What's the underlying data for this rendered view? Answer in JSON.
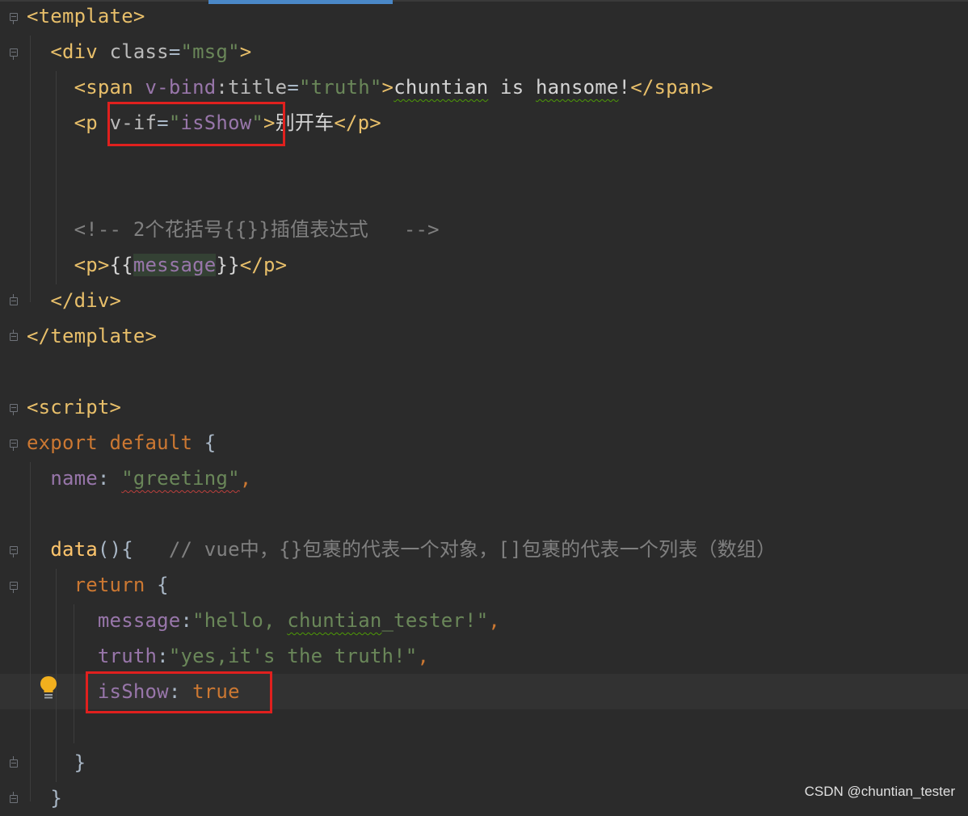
{
  "editor": {
    "lines": [
      {
        "tokens": [
          {
            "t": "<template>",
            "c": "tag"
          }
        ]
      },
      {
        "tokens": [
          {
            "t": "  "
          },
          {
            "t": "<div ",
            "c": "tag"
          },
          {
            "t": "class",
            "c": "attr"
          },
          {
            "t": "=",
            "c": "plain"
          },
          {
            "t": "\"msg\"",
            "c": "str"
          },
          {
            "t": ">",
            "c": "tag"
          }
        ]
      },
      {
        "tokens": [
          {
            "t": "    "
          },
          {
            "t": "<span ",
            "c": "tag"
          },
          {
            "t": "v-bind",
            "c": "vattr"
          },
          {
            "t": ":title",
            "c": "attr"
          },
          {
            "t": "=",
            "c": "plain"
          },
          {
            "t": "\"truth\"",
            "c": "str"
          },
          {
            "t": ">",
            "c": "tag"
          },
          {
            "t": "chuntian",
            "c": "txt squig"
          },
          {
            "t": " is ",
            "c": "txt"
          },
          {
            "t": "hansome",
            "c": "txt squig"
          },
          {
            "t": "!",
            "c": "txt"
          },
          {
            "t": "</span>",
            "c": "tag"
          }
        ]
      },
      {
        "tokens": [
          {
            "t": "    "
          },
          {
            "t": "<p ",
            "c": "tag"
          },
          {
            "t": "v-if",
            "c": "attr"
          },
          {
            "t": "=",
            "c": "plain"
          },
          {
            "t": "\"",
            "c": "str"
          },
          {
            "t": "isShow",
            "c": "vattr"
          },
          {
            "t": "\"",
            "c": "str"
          },
          {
            "t": ">",
            "c": "tag"
          },
          {
            "t": "别开车",
            "c": "txt"
          },
          {
            "t": "</p>",
            "c": "tag"
          }
        ]
      },
      {
        "tokens": []
      },
      {
        "tokens": []
      },
      {
        "tokens": [
          {
            "t": "    "
          },
          {
            "t": "<!-- 2个花括号{{}}插值表达式   -->",
            "c": "cm"
          }
        ]
      },
      {
        "tokens": [
          {
            "t": "    "
          },
          {
            "t": "<p>",
            "c": "tag"
          },
          {
            "t": "{{",
            "c": "txt"
          },
          {
            "t": "message",
            "c": "prop hl"
          },
          {
            "t": "}}",
            "c": "txt"
          },
          {
            "t": "</p>",
            "c": "tag"
          }
        ]
      },
      {
        "tokens": [
          {
            "t": "  "
          },
          {
            "t": "</div>",
            "c": "tag"
          }
        ]
      },
      {
        "tokens": [
          {
            "t": "</template>",
            "c": "tag"
          }
        ]
      },
      {
        "tokens": []
      },
      {
        "tokens": [
          {
            "t": "<script>",
            "c": "tag"
          }
        ]
      },
      {
        "tokens": [
          {
            "t": "export default ",
            "c": "kw"
          },
          {
            "t": "{",
            "c": "plain"
          }
        ]
      },
      {
        "tokens": [
          {
            "t": "  "
          },
          {
            "t": "name",
            "c": "prop"
          },
          {
            "t": ": ",
            "c": "plain"
          },
          {
            "t": "\"greeting\"",
            "c": "str squig-red"
          },
          {
            "t": ",",
            "c": "kw"
          }
        ]
      },
      {
        "tokens": []
      },
      {
        "tokens": [
          {
            "t": "  "
          },
          {
            "t": "data",
            "c": "fn"
          },
          {
            "t": "(){",
            "c": "plain"
          },
          {
            "t": "   // vue中，{}包裹的代表一个对象，[]包裹的代表一个列表（数组）",
            "c": "cm"
          }
        ]
      },
      {
        "tokens": [
          {
            "t": "    "
          },
          {
            "t": "return ",
            "c": "kw"
          },
          {
            "t": "{",
            "c": "plain"
          }
        ]
      },
      {
        "tokens": [
          {
            "t": "      "
          },
          {
            "t": "message",
            "c": "prop"
          },
          {
            "t": ":",
            "c": "plain"
          },
          {
            "t": "\"hello, ",
            "c": "str"
          },
          {
            "t": "chuntian",
            "c": "str squig"
          },
          {
            "t": "_tester!\"",
            "c": "str"
          },
          {
            "t": ",",
            "c": "kw"
          }
        ]
      },
      {
        "tokens": [
          {
            "t": "      "
          },
          {
            "t": "truth",
            "c": "prop"
          },
          {
            "t": ":",
            "c": "plain"
          },
          {
            "t": "\"yes,it's the truth!\"",
            "c": "str"
          },
          {
            "t": ",",
            "c": "kw"
          }
        ]
      },
      {
        "tokens": [
          {
            "t": "      "
          },
          {
            "t": "isShow",
            "c": "prop"
          },
          {
            "t": ": ",
            "c": "plain"
          },
          {
            "t": "true",
            "c": "kw"
          }
        ]
      },
      {
        "tokens": []
      },
      {
        "tokens": [
          {
            "t": "    "
          },
          {
            "t": "}",
            "c": "plain"
          }
        ]
      },
      {
        "tokens": [
          {
            "t": "  "
          },
          {
            "t": "}",
            "c": "plain"
          }
        ]
      }
    ]
  },
  "watermark": "CSDN @chuntian_tester"
}
